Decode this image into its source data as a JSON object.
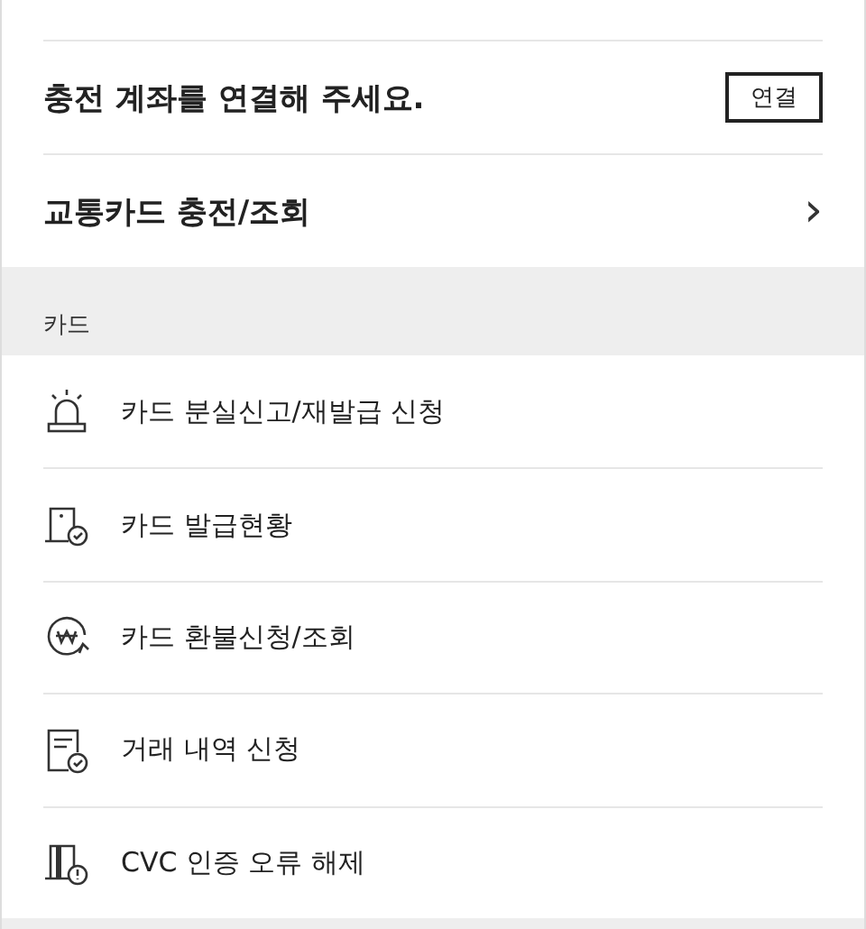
{
  "account": {
    "message": "충전 계좌를 연결해 주세요.",
    "button": "연결"
  },
  "transit": {
    "label": "교통카드 충전/조회",
    "chevron": "›"
  },
  "section": {
    "title": "카드",
    "items": [
      {
        "label": "카드 분실신고/재발급 신청",
        "kind": "siren"
      },
      {
        "label": "카드 발급현황",
        "kind": "card-check"
      },
      {
        "label": "카드 환불신청/조회",
        "kind": "won"
      },
      {
        "label": "거래 내역 신청",
        "kind": "document"
      },
      {
        "label": "CVC 인증 오류 해제",
        "kind": "alert"
      }
    ]
  }
}
